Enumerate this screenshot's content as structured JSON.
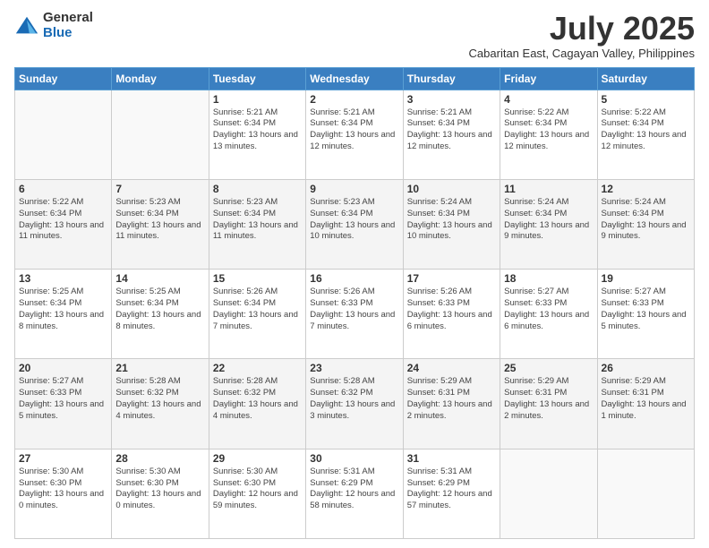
{
  "header": {
    "logo_general": "General",
    "logo_blue": "Blue",
    "main_title": "July 2025",
    "subtitle": "Cabaritan East, Cagayan Valley, Philippines"
  },
  "weekdays": [
    "Sunday",
    "Monday",
    "Tuesday",
    "Wednesday",
    "Thursday",
    "Friday",
    "Saturday"
  ],
  "weeks": [
    [
      {
        "day": "",
        "info": ""
      },
      {
        "day": "",
        "info": ""
      },
      {
        "day": "1",
        "info": "Sunrise: 5:21 AM\nSunset: 6:34 PM\nDaylight: 13 hours and 13 minutes."
      },
      {
        "day": "2",
        "info": "Sunrise: 5:21 AM\nSunset: 6:34 PM\nDaylight: 13 hours and 12 minutes."
      },
      {
        "day": "3",
        "info": "Sunrise: 5:21 AM\nSunset: 6:34 PM\nDaylight: 13 hours and 12 minutes."
      },
      {
        "day": "4",
        "info": "Sunrise: 5:22 AM\nSunset: 6:34 PM\nDaylight: 13 hours and 12 minutes."
      },
      {
        "day": "5",
        "info": "Sunrise: 5:22 AM\nSunset: 6:34 PM\nDaylight: 13 hours and 12 minutes."
      }
    ],
    [
      {
        "day": "6",
        "info": "Sunrise: 5:22 AM\nSunset: 6:34 PM\nDaylight: 13 hours and 11 minutes."
      },
      {
        "day": "7",
        "info": "Sunrise: 5:23 AM\nSunset: 6:34 PM\nDaylight: 13 hours and 11 minutes."
      },
      {
        "day": "8",
        "info": "Sunrise: 5:23 AM\nSunset: 6:34 PM\nDaylight: 13 hours and 11 minutes."
      },
      {
        "day": "9",
        "info": "Sunrise: 5:23 AM\nSunset: 6:34 PM\nDaylight: 13 hours and 10 minutes."
      },
      {
        "day": "10",
        "info": "Sunrise: 5:24 AM\nSunset: 6:34 PM\nDaylight: 13 hours and 10 minutes."
      },
      {
        "day": "11",
        "info": "Sunrise: 5:24 AM\nSunset: 6:34 PM\nDaylight: 13 hours and 9 minutes."
      },
      {
        "day": "12",
        "info": "Sunrise: 5:24 AM\nSunset: 6:34 PM\nDaylight: 13 hours and 9 minutes."
      }
    ],
    [
      {
        "day": "13",
        "info": "Sunrise: 5:25 AM\nSunset: 6:34 PM\nDaylight: 13 hours and 8 minutes."
      },
      {
        "day": "14",
        "info": "Sunrise: 5:25 AM\nSunset: 6:34 PM\nDaylight: 13 hours and 8 minutes."
      },
      {
        "day": "15",
        "info": "Sunrise: 5:26 AM\nSunset: 6:34 PM\nDaylight: 13 hours and 7 minutes."
      },
      {
        "day": "16",
        "info": "Sunrise: 5:26 AM\nSunset: 6:33 PM\nDaylight: 13 hours and 7 minutes."
      },
      {
        "day": "17",
        "info": "Sunrise: 5:26 AM\nSunset: 6:33 PM\nDaylight: 13 hours and 6 minutes."
      },
      {
        "day": "18",
        "info": "Sunrise: 5:27 AM\nSunset: 6:33 PM\nDaylight: 13 hours and 6 minutes."
      },
      {
        "day": "19",
        "info": "Sunrise: 5:27 AM\nSunset: 6:33 PM\nDaylight: 13 hours and 5 minutes."
      }
    ],
    [
      {
        "day": "20",
        "info": "Sunrise: 5:27 AM\nSunset: 6:33 PM\nDaylight: 13 hours and 5 minutes."
      },
      {
        "day": "21",
        "info": "Sunrise: 5:28 AM\nSunset: 6:32 PM\nDaylight: 13 hours and 4 minutes."
      },
      {
        "day": "22",
        "info": "Sunrise: 5:28 AM\nSunset: 6:32 PM\nDaylight: 13 hours and 4 minutes."
      },
      {
        "day": "23",
        "info": "Sunrise: 5:28 AM\nSunset: 6:32 PM\nDaylight: 13 hours and 3 minutes."
      },
      {
        "day": "24",
        "info": "Sunrise: 5:29 AM\nSunset: 6:31 PM\nDaylight: 13 hours and 2 minutes."
      },
      {
        "day": "25",
        "info": "Sunrise: 5:29 AM\nSunset: 6:31 PM\nDaylight: 13 hours and 2 minutes."
      },
      {
        "day": "26",
        "info": "Sunrise: 5:29 AM\nSunset: 6:31 PM\nDaylight: 13 hours and 1 minute."
      }
    ],
    [
      {
        "day": "27",
        "info": "Sunrise: 5:30 AM\nSunset: 6:30 PM\nDaylight: 13 hours and 0 minutes."
      },
      {
        "day": "28",
        "info": "Sunrise: 5:30 AM\nSunset: 6:30 PM\nDaylight: 13 hours and 0 minutes."
      },
      {
        "day": "29",
        "info": "Sunrise: 5:30 AM\nSunset: 6:30 PM\nDaylight: 12 hours and 59 minutes."
      },
      {
        "day": "30",
        "info": "Sunrise: 5:31 AM\nSunset: 6:29 PM\nDaylight: 12 hours and 58 minutes."
      },
      {
        "day": "31",
        "info": "Sunrise: 5:31 AM\nSunset: 6:29 PM\nDaylight: 12 hours and 57 minutes."
      },
      {
        "day": "",
        "info": ""
      },
      {
        "day": "",
        "info": ""
      }
    ]
  ]
}
